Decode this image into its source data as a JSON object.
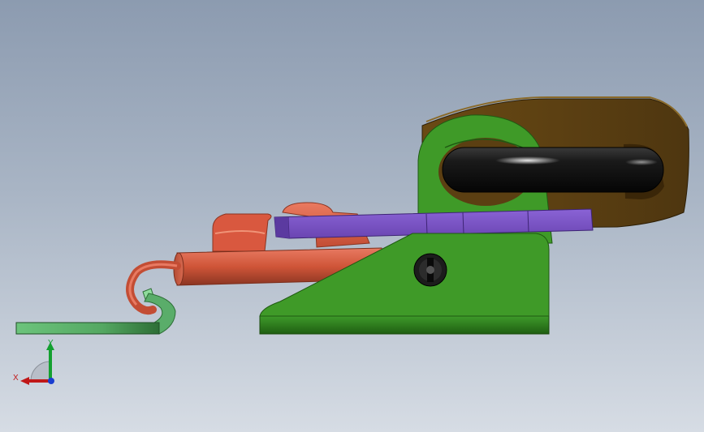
{
  "viewport": {
    "background_top": "#8c9bb0",
    "background_bottom": "#d6dce4"
  },
  "parts": [
    {
      "name": "mounting-plate",
      "color": "#5b3f12"
    },
    {
      "name": "pivot-bracket",
      "color": "#3f9a28"
    },
    {
      "name": "roller-cylinder",
      "color": "#141414"
    },
    {
      "name": "clamp-lever",
      "color": "#7b55c4"
    },
    {
      "name": "rubber-cap",
      "color": "#d9583f"
    },
    {
      "name": "hook-rod",
      "color": "#d9583f"
    },
    {
      "name": "latch-strip",
      "color": "#5aad6a"
    },
    {
      "name": "screw-head",
      "color": "#1c1c1c"
    }
  ],
  "triad": {
    "x_label": "X",
    "y_label": "Y",
    "x_color": "#c01818",
    "y_color": "#13a030",
    "z_color": "#1a3ed0"
  }
}
